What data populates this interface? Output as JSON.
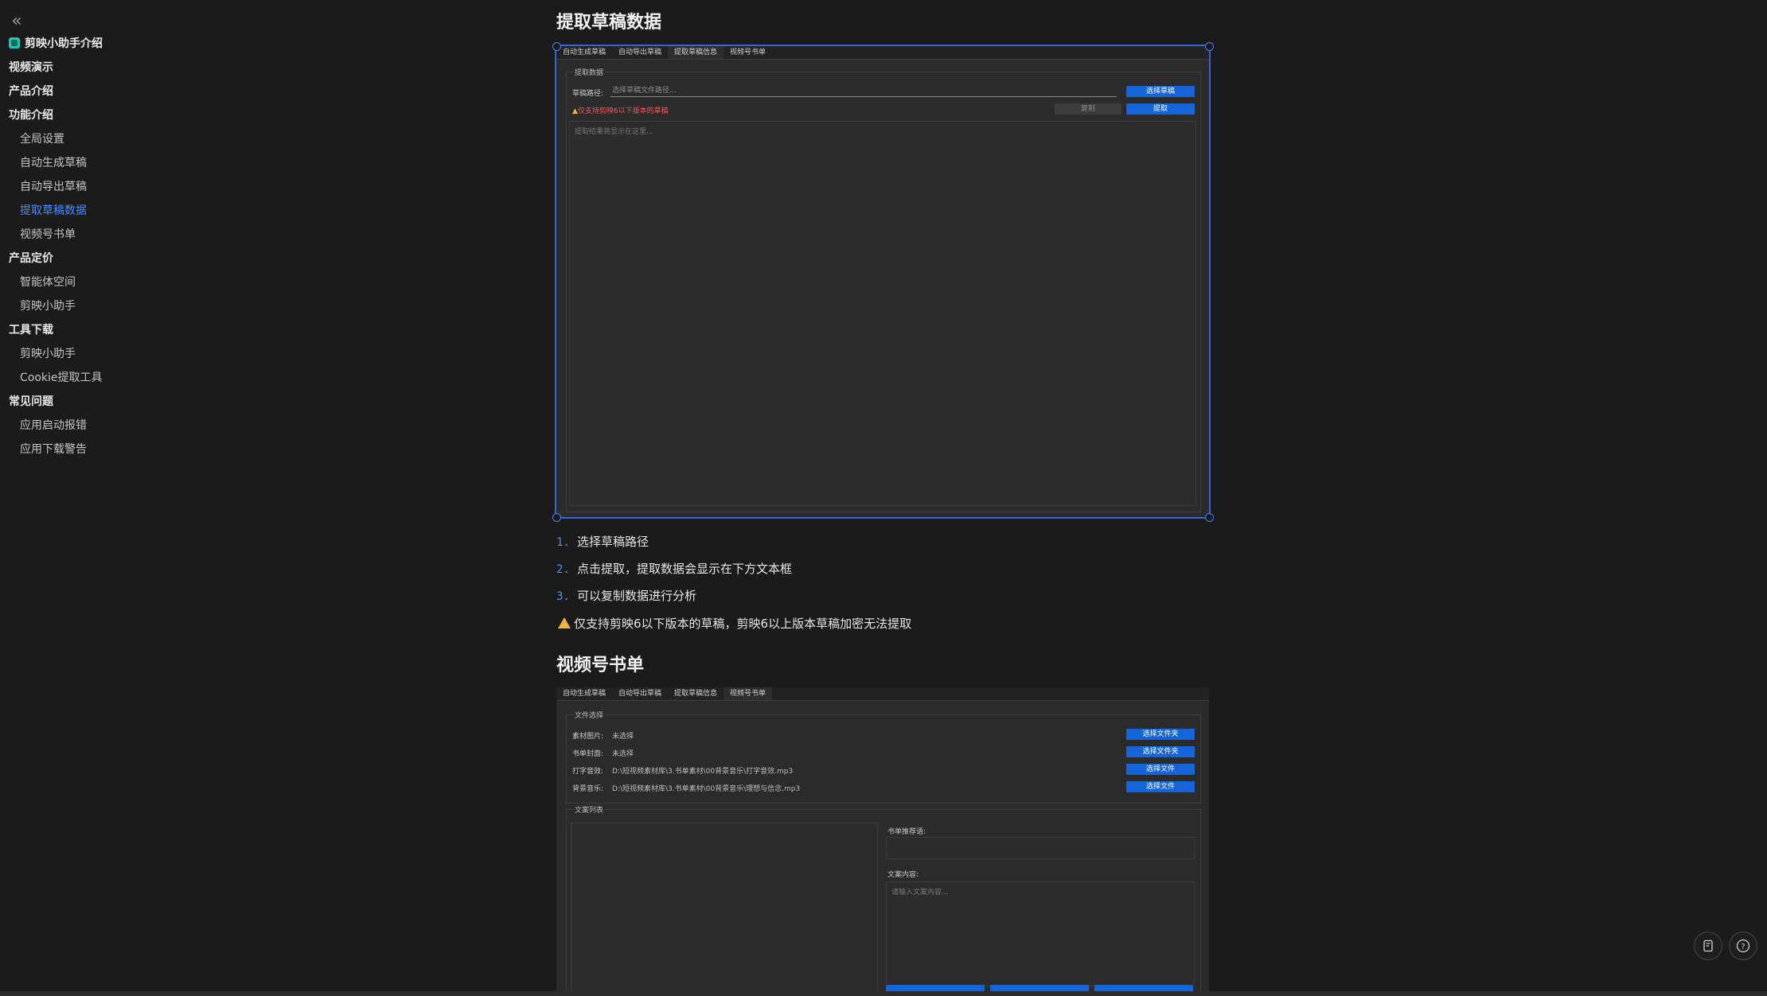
{
  "sidebar": {
    "collapse_symbol": "«",
    "items": [
      {
        "label": "剪映小助手介绍",
        "level": 1,
        "icon": "app-logo-icon"
      },
      {
        "label": "视频演示",
        "level": 1
      },
      {
        "label": "产品介绍",
        "level": 1
      },
      {
        "label": "功能介绍",
        "level": 1
      },
      {
        "label": "全局设置",
        "level": 2
      },
      {
        "label": "自动生成草稿",
        "level": 2
      },
      {
        "label": "自动导出草稿",
        "level": 2
      },
      {
        "label": "提取草稿数据",
        "level": 2,
        "active": true
      },
      {
        "label": "视频号书单",
        "level": 2
      },
      {
        "label": "产品定价",
        "level": 1
      },
      {
        "label": "智能体空间",
        "level": 2
      },
      {
        "label": "剪映小助手",
        "level": 2
      },
      {
        "label": "工具下载",
        "level": 1
      },
      {
        "label": "剪映小助手",
        "level": 2
      },
      {
        "label": "Cookie提取工具",
        "level": 2
      },
      {
        "label": "常见问题",
        "level": 1
      },
      {
        "label": "应用启动报错",
        "level": 2
      },
      {
        "label": "应用下载警告",
        "level": 2
      }
    ]
  },
  "section1": {
    "title": "提取草稿数据",
    "app": {
      "tabs": [
        "自动生成草稿",
        "自动导出草稿",
        "提取草稿信息",
        "视频号书单"
      ],
      "group_title": "提取数据",
      "path_label": "草稿路径:",
      "path_placeholder": "选择草稿文件路径...",
      "select_button": "选择草稿",
      "warning": "仅支持剪映6以下版本的草稿",
      "copy_button": "复制",
      "extract_button": "提取",
      "result_placeholder": "提取结果将显示在这里..."
    },
    "steps": [
      {
        "num": "1.",
        "text": "选择草稿路径"
      },
      {
        "num": "2.",
        "text": "点击提取，提取数据会显示在下方文本框"
      },
      {
        "num": "3.",
        "text": "可以复制数据进行分析"
      }
    ],
    "note": "仅支持剪映6以下版本的草稿，剪映6以上版本草稿加密无法提取"
  },
  "section2": {
    "title": "视频号书单",
    "app": {
      "tabs": [
        "自动生成草稿",
        "自动导出草稿",
        "提取草稿信息",
        "视频号书单"
      ],
      "file_group_title": "文件选择",
      "rows": [
        {
          "label": "素材图片:",
          "value": "未选择",
          "button": "选择文件夹"
        },
        {
          "label": "书单封面:",
          "value": "未选择",
          "button": "选择文件夹"
        },
        {
          "label": "打字音效:",
          "value": "D:\\短视频素材库\\3.书单素材\\00背景音乐\\打字音效.mp3",
          "button": "选择文件"
        },
        {
          "label": "背景音乐:",
          "value": "D:\\短视频素材库\\3.书单素材\\00背景音乐\\理想与信念.mp3",
          "button": "选择文件"
        }
      ],
      "copy_group_title": "文案列表",
      "recommend_label": "书单推荐语:",
      "content_label": "文案内容:",
      "content_placeholder": "请输入文案内容..."
    }
  },
  "fabs": {
    "left_icon": "document-icon",
    "right_icon": "help-icon",
    "right_symbol": "?"
  },
  "colors": {
    "accent": "#4a8cff",
    "button_blue": "#1565d8",
    "warning": "#f5b53b"
  }
}
